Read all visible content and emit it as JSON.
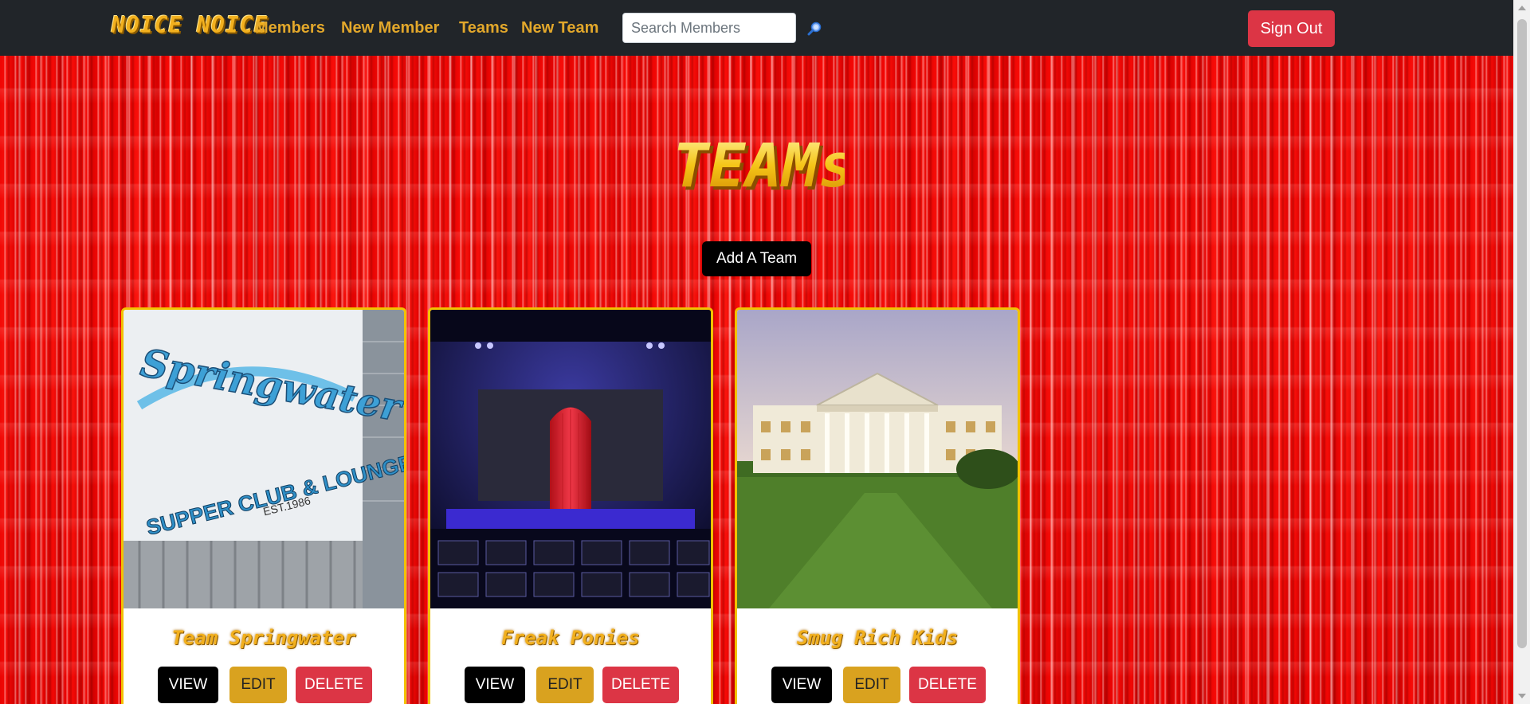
{
  "nav": {
    "brand": "NOICE NOICE",
    "links": [
      "Members",
      "New Member",
      "Teams",
      "New Team"
    ],
    "search_placeholder": "Search Members",
    "search_icon": "magnifier-icon",
    "sign_out": "Sign Out"
  },
  "page": {
    "title": "TEAMs",
    "add_button": "Add A Team"
  },
  "teams": [
    {
      "name": "Team Springwater",
      "image": "springwater-supper-club-sign",
      "image_text_1": "Springwater",
      "image_text_2": "SUPPER CLUB & LOUNGE",
      "image_text_3": "EST.1986",
      "view": "VIEW",
      "edit": "EDIT",
      "delete": "DELETE"
    },
    {
      "name": "Freak Ponies",
      "image": "theater-stage-red-curtain",
      "view": "VIEW",
      "edit": "EDIT",
      "delete": "DELETE"
    },
    {
      "name": "Smug Rich Kids",
      "image": "mansion-lawn",
      "view": "VIEW",
      "edit": "EDIT",
      "delete": "DELETE"
    }
  ],
  "colors": {
    "navbar": "#212529",
    "nav_link": "#e3a82b",
    "danger": "#dc3545",
    "warning": "#d9a21f",
    "card_border": "#f2c200"
  }
}
